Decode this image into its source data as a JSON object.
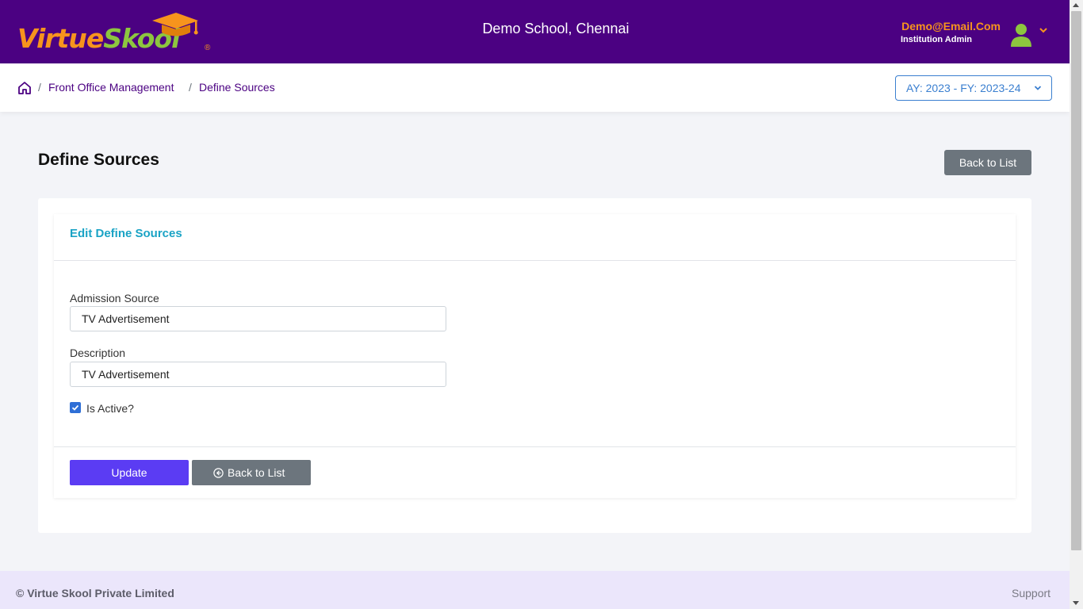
{
  "header": {
    "logo_name": "VirtueSkool",
    "logo_part1": "Virtue",
    "logo_part2": "Skool",
    "logo_reg": "®",
    "school_name": "Demo School, Chennai",
    "user_email": "Demo@Email.Com",
    "user_role": "Institution Admin",
    "icons": [
      "graduation-cap-icon",
      "user-avatar-icon",
      "chevron-down-icon"
    ]
  },
  "breadcrumb": {
    "separator": "/",
    "items": [
      "Front Office Management",
      "Define Sources"
    ],
    "academic_year": "AY: 2023 - FY: 2023-24"
  },
  "page": {
    "title": "Define Sources",
    "back_to_list": "Back to List"
  },
  "form": {
    "card_title": "Edit Define Sources",
    "admission_source_label": "Admission Source",
    "admission_source_value": "TV Advertisement",
    "description_label": "Description",
    "description_value": "TV Advertisement",
    "is_active_label": "Is Active?",
    "is_active_checked": true,
    "update_label": "Update",
    "back_label": "Back to List"
  },
  "footer": {
    "copyright": "© Virtue Skool Private Limited",
    "support": "Support"
  },
  "colors": {
    "header_bg": "#4b0182",
    "brand_orange": "#f7941d",
    "brand_green": "#8dc63f",
    "card_title": "#1aa3c5",
    "update_button": "#5b3cf3",
    "secondary_button": "#6c757d",
    "footer_bg": "#ebe6fb"
  }
}
